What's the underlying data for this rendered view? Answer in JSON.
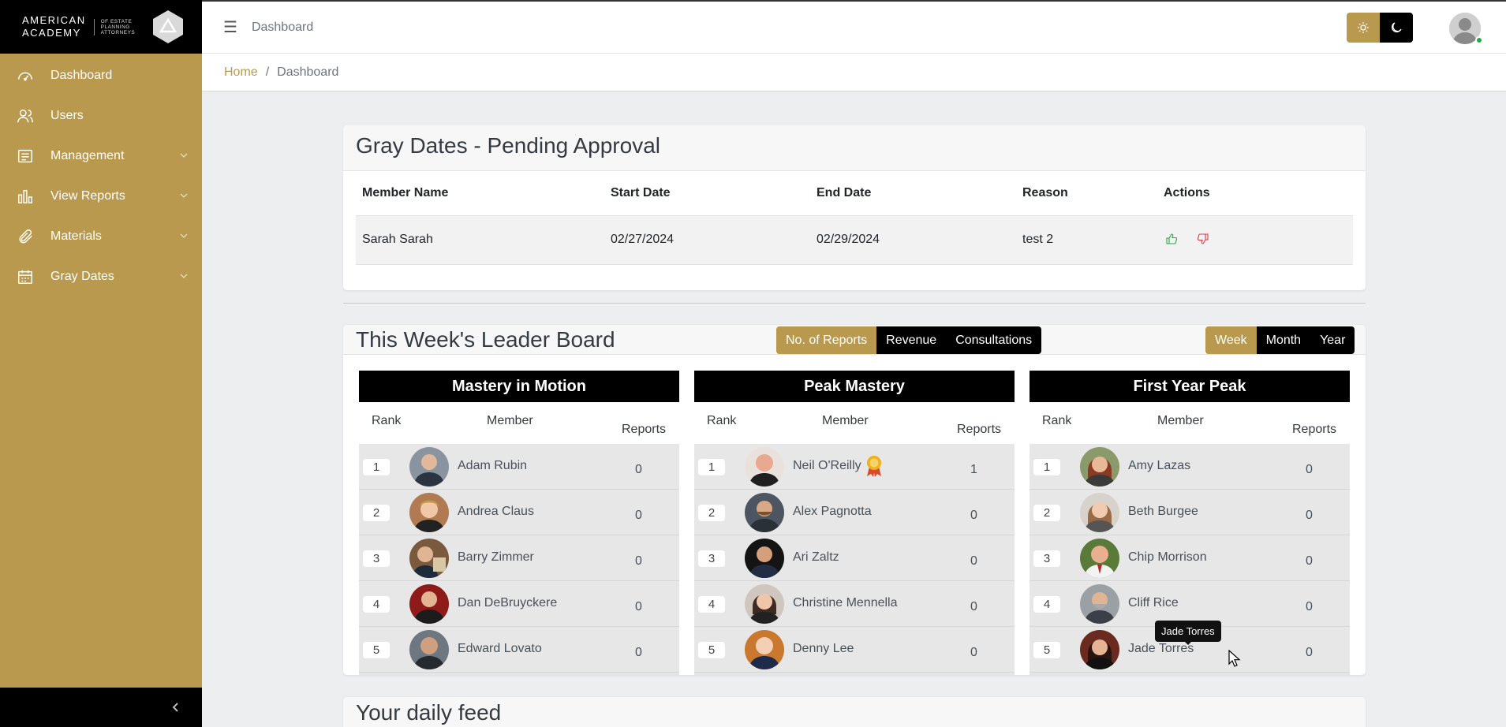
{
  "brand": {
    "line1": "AMERICAN",
    "line2": "ACADEMY",
    "small1": "OF ESTATE",
    "small2": "PLANNING",
    "small3": "ATTORNEYS"
  },
  "sidebar": {
    "items": [
      {
        "label": "Dashboard",
        "icon": "dashboard-gauge-icon"
      },
      {
        "label": "Users",
        "icon": "users-icon"
      },
      {
        "label": "Management",
        "icon": "list-icon",
        "expandable": true
      },
      {
        "label": "View Reports",
        "icon": "bar-chart-icon",
        "expandable": true
      },
      {
        "label": "Materials",
        "icon": "paperclip-icon",
        "expandable": true
      },
      {
        "label": "Gray Dates",
        "icon": "calendar-icon",
        "expandable": true
      }
    ]
  },
  "header": {
    "title": "Dashboard"
  },
  "breadcrumb": {
    "home": "Home",
    "separator": "/",
    "current": "Dashboard"
  },
  "gray_dates": {
    "title": "Gray Dates - Pending Approval",
    "columns": [
      "Member Name",
      "Start Date",
      "End Date",
      "Reason",
      "Actions"
    ],
    "rows": [
      {
        "member": "Sarah Sarah",
        "start": "02/27/2024",
        "end": "02/29/2024",
        "reason": "test 2"
      }
    ]
  },
  "leaderboard": {
    "title": "This Week's Leader Board",
    "metric_tabs": [
      "No. of Reports",
      "Revenue",
      "Consultations"
    ],
    "active_metric": "No. of Reports",
    "period_tabs": [
      "Week",
      "Month",
      "Year"
    ],
    "active_period": "Week",
    "col_rank": "Rank",
    "col_member": "Member",
    "col_reports": "Reports",
    "boards": [
      {
        "title": "Mastery in Motion",
        "rows": [
          {
            "rank": "1",
            "name": "Adam Rubin",
            "value": "0"
          },
          {
            "rank": "2",
            "name": "Andrea Claus",
            "value": "0"
          },
          {
            "rank": "3",
            "name": "Barry Zimmer",
            "value": "0"
          },
          {
            "rank": "4",
            "name": "Dan DeBruyckere",
            "value": "0"
          },
          {
            "rank": "5",
            "name": "Edward Lovato",
            "value": "0"
          }
        ]
      },
      {
        "title": "Peak Mastery",
        "rows": [
          {
            "rank": "1",
            "name": "Neil O'Reilly",
            "value": "1"
          },
          {
            "rank": "2",
            "name": "Alex Pagnotta",
            "value": "0"
          },
          {
            "rank": "3",
            "name": "Ari Zaltz",
            "value": "0"
          },
          {
            "rank": "4",
            "name": "Christine Mennella",
            "value": "0"
          },
          {
            "rank": "5",
            "name": "Denny Lee",
            "value": "0"
          }
        ]
      },
      {
        "title": "First Year Peak",
        "rows": [
          {
            "rank": "1",
            "name": "Amy Lazas",
            "value": "0"
          },
          {
            "rank": "2",
            "name": "Beth Burgee",
            "value": "0"
          },
          {
            "rank": "3",
            "name": "Chip Morrison",
            "value": "0"
          },
          {
            "rank": "4",
            "name": "Cliff Rice",
            "value": "0"
          },
          {
            "rank": "5",
            "name": "Jade Torres",
            "value": "0"
          }
        ]
      }
    ]
  },
  "feed": {
    "title": "Your daily feed"
  },
  "tooltip": {
    "text": "Jade Torres"
  },
  "colors": {
    "accent": "#b8994d",
    "dark": "#000000",
    "approve": "#28a745",
    "reject": "#dc3545"
  }
}
